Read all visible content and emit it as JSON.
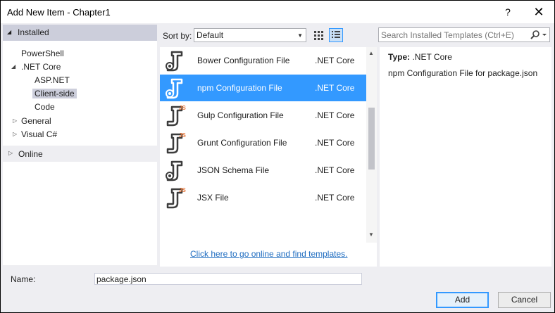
{
  "window": {
    "title": "Add New Item - Chapter1",
    "help_glyph": "?",
    "close_glyph": "✕"
  },
  "left_pane": {
    "installed_label": "Installed",
    "tree": [
      {
        "label": "PowerShell",
        "expander": ""
      },
      {
        "label": ".NET Core",
        "expander": "◢"
      },
      {
        "label": "ASP.NET",
        "expander": ""
      },
      {
        "label": "Client-side",
        "expander": "",
        "selected": true
      },
      {
        "label": "Code",
        "expander": ""
      },
      {
        "label": "General",
        "expander": "▷"
      },
      {
        "label": "Visual C#",
        "expander": "▷"
      }
    ],
    "online_label": "Online"
  },
  "toolbar": {
    "sort_label": "Sort by:",
    "sort_value": "Default",
    "search_placeholder": "Search Installed Templates (Ctrl+E)"
  },
  "templates": [
    {
      "name": "Bower Configuration File",
      "type": ".NET Core",
      "icon": "bower-config-icon",
      "js_badge": false
    },
    {
      "name": "npm Configuration File",
      "type": ".NET Core",
      "icon": "npm-config-icon",
      "js_badge": false,
      "selected": true
    },
    {
      "name": "Gulp Configuration File",
      "type": ".NET Core",
      "icon": "gulp-config-icon",
      "js_badge": true
    },
    {
      "name": "Grunt Configuration File",
      "type": ".NET Core",
      "icon": "grunt-config-icon",
      "js_badge": true
    },
    {
      "name": "JSON Schema File",
      "type": ".NET Core",
      "icon": "json-schema-icon",
      "js_badge": false
    },
    {
      "name": "JSX File",
      "type": ".NET Core",
      "icon": "jsx-file-icon",
      "js_badge": true
    }
  ],
  "online_link": "Click here to go online and find templates.",
  "detail": {
    "type_label": "Type:",
    "type_value": ".NET Core",
    "description": "npm Configuration File for package.json"
  },
  "bottom": {
    "name_label": "Name:",
    "name_value": "package.json",
    "add_label": "Add",
    "cancel_label": "Cancel"
  },
  "colors": {
    "selection": "#3399ff",
    "tree_selection": "#cccedb",
    "link": "#1e6cc0",
    "js_badge": "#e8773a"
  }
}
